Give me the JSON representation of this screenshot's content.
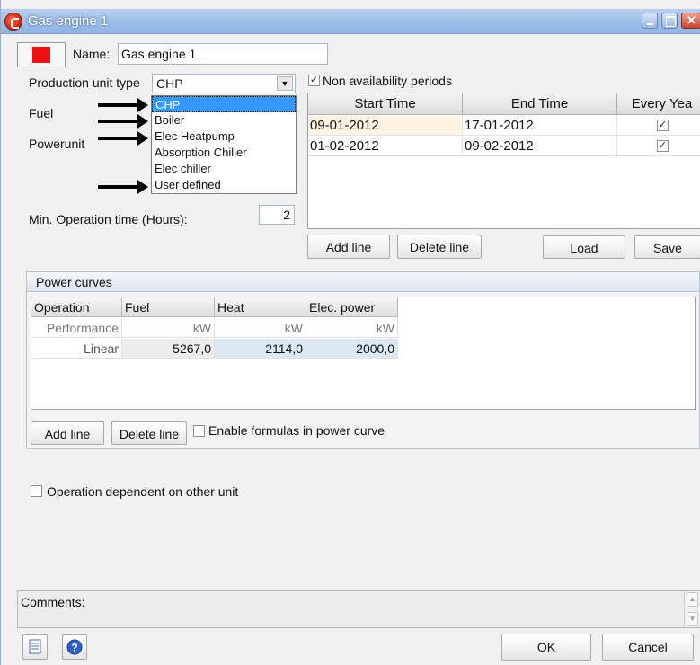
{
  "window": {
    "title": "Gas engine 1"
  },
  "header": {
    "name_label": "Name:",
    "name_value": "Gas engine 1",
    "color": "#ee1111"
  },
  "left": {
    "production_type_label": "Production unit type",
    "production_type_value": "CHP",
    "fuel_label": "Fuel",
    "powerunit_label": "Powerunit",
    "min_op_label": "Min. Operation time (Hours):",
    "min_op_value": "2"
  },
  "dropdown": {
    "options": [
      "CHP",
      "Boiler",
      "Elec Heatpump",
      "Absorption Chiller",
      "Elec chiller",
      "User defined"
    ],
    "selected": "CHP"
  },
  "non_availability": {
    "checkbox_label": "Non availability periods",
    "checked": true,
    "columns": [
      "Start Time",
      "End Time",
      "Every Yea"
    ],
    "rows": [
      {
        "start": "09-01-2012",
        "end": "17-01-2012",
        "every_year": true
      },
      {
        "start": "01-02-2012",
        "end": "09-02-2012",
        "every_year": true
      }
    ],
    "buttons": {
      "add": "Add line",
      "delete": "Delete line",
      "load": "Load",
      "save": "Save"
    }
  },
  "power_curves": {
    "title": "Power curves",
    "columns": [
      "Operation",
      "Fuel",
      "Heat",
      "Elec. power"
    ],
    "rows": [
      [
        "Performance",
        "kW",
        "kW",
        "kW"
      ],
      [
        "Linear",
        "5267,0",
        "2114,0",
        "2000,0"
      ]
    ],
    "buttons": {
      "add": "Add line",
      "delete": "Delete line"
    },
    "formulas_label": "Enable formulas in power curve"
  },
  "operation_dependent_label": "Operation dependent on other unit",
  "comments_label": "Comments:",
  "footer": {
    "ok": "OK",
    "cancel": "Cancel"
  },
  "icons": [
    "app-logo-icon",
    "minimize-icon",
    "maximize-icon",
    "close-icon",
    "document-icon",
    "help-icon",
    "dropdown-arrow-icon",
    "checkmark-icon",
    "arrow-pointer-icon"
  ]
}
